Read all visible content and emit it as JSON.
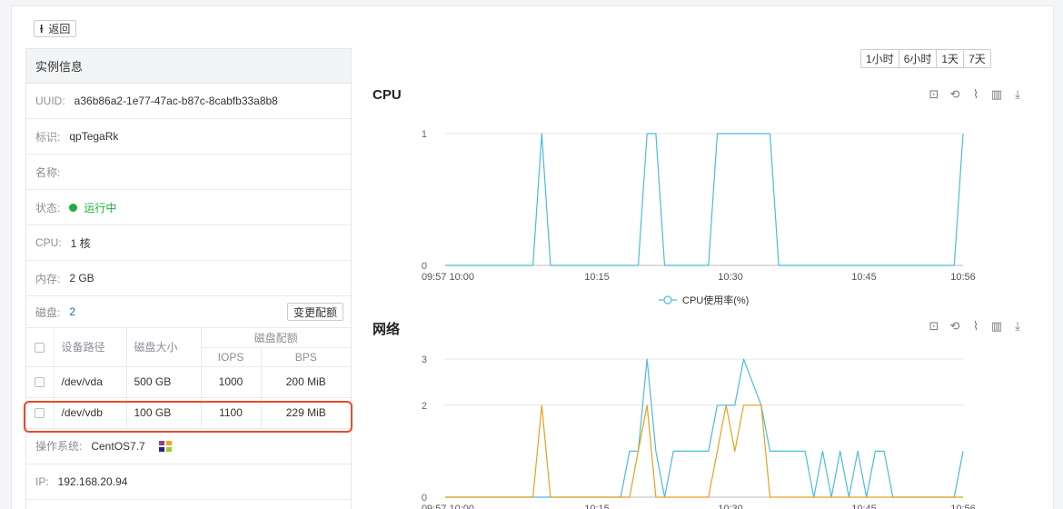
{
  "back": {
    "label": "返回"
  },
  "panel": {
    "title": "实例信息",
    "uuid_label": "UUID:",
    "uuid_value": "a36b86a2-1e77-47ac-b87c-8cabfb33a8b8",
    "tag_label": "标识:",
    "tag_value": "qpTegaRk",
    "name_label": "名称:",
    "name_value": "",
    "status_label": "状态:",
    "status_value": "运行中",
    "cpu_label": "CPU:",
    "cpu_value": "1 核",
    "mem_label": "内存:",
    "mem_value": "2 GB",
    "disk_label": "磁盘:",
    "disk_count": "2",
    "change_button": "变更配额",
    "disk_table": {
      "col_path": "设备路径",
      "col_size": "磁盘大小",
      "col_quota": "磁盘配额",
      "col_iops": "IOPS",
      "col_bps": "BPS",
      "rows": [
        {
          "path": "/dev/vda",
          "size": "500 GB",
          "iops": "1000",
          "bps": "200 MiB"
        },
        {
          "path": "/dev/vdb",
          "size": "100 GB",
          "iops": "1100",
          "bps": "229 MiB"
        }
      ]
    },
    "os_label": "操作系统:",
    "os_value": "CentOS7.7",
    "ip_label": "IP:",
    "ip_value": "192.168.20.94"
  },
  "range_buttons": [
    "1小时",
    "6小时",
    "1天",
    "7天"
  ],
  "tool_icons": [
    "zoom-icon",
    "zoom-reset-icon",
    "line-chart-icon",
    "bar-chart-icon",
    "download-icon"
  ],
  "chart_data": [
    {
      "type": "line",
      "title": "CPU",
      "x_ticks": [
        "09:57 10:00",
        "10:15",
        "10:30",
        "10:45",
        "10:56"
      ],
      "y_ticks": [
        "0",
        "1"
      ],
      "ylim": [
        0,
        1
      ],
      "x_minutes_range": [
        0,
        59
      ],
      "legend": "CPU使用率(%)",
      "legend_position": "bottom-center",
      "grid": true,
      "series": [
        {
          "name": "CPU使用率(%)",
          "color": "#4bbcdb",
          "points": [
            [
              0,
              0
            ],
            [
              10,
              0
            ],
            [
              11,
              1
            ],
            [
              12,
              0
            ],
            [
              22,
              0
            ],
            [
              23,
              1
            ],
            [
              24,
              1
            ],
            [
              25,
              0
            ],
            [
              30,
              0
            ],
            [
              31,
              1
            ],
            [
              37,
              1
            ],
            [
              38,
              0
            ],
            [
              58,
              0
            ],
            [
              59,
              1
            ]
          ]
        }
      ]
    },
    {
      "type": "line",
      "title": "网络",
      "x_ticks": [
        "09:57 10:00",
        "10:15",
        "10:30",
        "10:45",
        "10:56"
      ],
      "y_ticks": [
        "0",
        "2",
        "3"
      ],
      "ylim": [
        0,
        3.3
      ],
      "x_minutes_range": [
        0,
        59
      ],
      "grid": true,
      "series": [
        {
          "color": "#4bbcdb",
          "points": [
            [
              0,
              0
            ],
            [
              20,
              0
            ],
            [
              21,
              1
            ],
            [
              22,
              1
            ],
            [
              23,
              3
            ],
            [
              24,
              1
            ],
            [
              25,
              0
            ],
            [
              26,
              1
            ],
            [
              30,
              1
            ],
            [
              31,
              2
            ],
            [
              33,
              2
            ],
            [
              34,
              3
            ],
            [
              36,
              2
            ],
            [
              37,
              1
            ],
            [
              41,
              1
            ],
            [
              42,
              0
            ],
            [
              43,
              1
            ],
            [
              44,
              0
            ],
            [
              45,
              1
            ],
            [
              46,
              0
            ],
            [
              47,
              1
            ],
            [
              48,
              0
            ],
            [
              49,
              1
            ],
            [
              50,
              1
            ],
            [
              51,
              0
            ],
            [
              58,
              0
            ],
            [
              59,
              1
            ]
          ]
        },
        {
          "color": "#e8a11e",
          "points": [
            [
              0,
              0
            ],
            [
              10,
              0
            ],
            [
              11,
              2
            ],
            [
              12,
              0
            ],
            [
              21,
              0
            ],
            [
              22,
              1
            ],
            [
              23,
              2
            ],
            [
              24,
              0
            ],
            [
              30,
              0
            ],
            [
              31,
              1
            ],
            [
              32,
              2
            ],
            [
              33,
              1
            ],
            [
              34,
              2
            ],
            [
              36,
              2
            ],
            [
              37,
              0
            ],
            [
              59,
              0
            ]
          ]
        }
      ]
    }
  ]
}
